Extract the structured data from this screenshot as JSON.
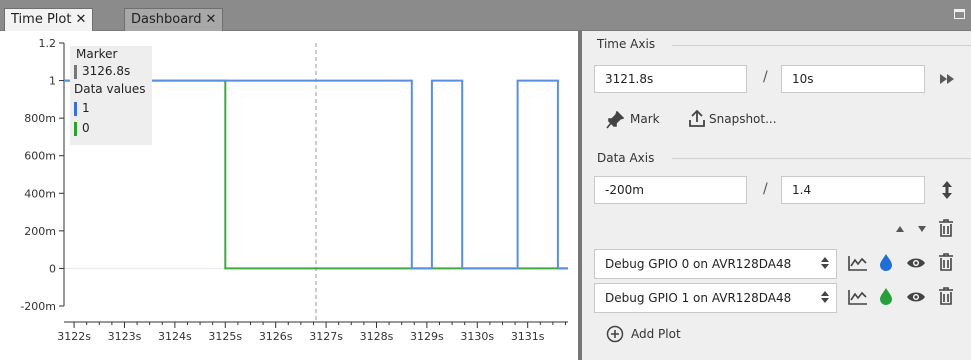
{
  "tabs": [
    {
      "label": "Time Plot",
      "close": "✕"
    },
    {
      "label": "Dashboard",
      "close": "✕"
    }
  ],
  "chart_data": {
    "type": "line",
    "x_ticks": [
      "3122s",
      "3123s",
      "3124s",
      "3125s",
      "3126s",
      "3127s",
      "3128s",
      "3129s",
      "3130s",
      "3131s"
    ],
    "y_ticks": [
      "1.2",
      "1",
      "800m",
      "600m",
      "400m",
      "200m",
      "0",
      "-200m"
    ],
    "y_tick_values": [
      1.2,
      1,
      0.8,
      0.6,
      0.4,
      0.2,
      0,
      -0.2
    ],
    "xlim": [
      3121.8,
      3131.8
    ],
    "ylim": [
      -0.2,
      1.2
    ],
    "marker": 3126.8,
    "series": [
      {
        "color": "#5b8ee0",
        "x": [
          3121.8,
          3128.7,
          3128.7,
          3129.1,
          3129.1,
          3129.7,
          3129.7,
          3130.8,
          3130.8,
          3131.6,
          3131.6,
          3131.8
        ],
        "y": [
          1,
          1,
          0,
          0,
          1,
          1,
          0,
          0,
          1,
          1,
          0,
          0
        ]
      },
      {
        "color": "#3faa3f",
        "x": [
          3121.8,
          3125.0,
          3125.0,
          3131.8
        ],
        "y": [
          1,
          1,
          0,
          0
        ]
      }
    ]
  },
  "legend": {
    "marker_title": "Marker",
    "marker_value": "3126.8s",
    "values_title": "Data values",
    "values": [
      {
        "value": "1",
        "color": "#3b6fdc"
      },
      {
        "value": "0",
        "color": "#2fa02f"
      }
    ]
  },
  "panel": {
    "time_axis_label": "Time Axis",
    "time_start": "3121.8s",
    "time_span": "10s",
    "slash": "/",
    "mark_label": "Mark",
    "snapshot_label": "Snapshot...",
    "data_axis_label": "Data Axis",
    "data_min": "-200m",
    "data_span": "1.4",
    "plots": [
      {
        "source": "Debug GPIO 0 on AVR128DA48",
        "drop_color": "#1f6fd6"
      },
      {
        "source": "Debug GPIO 1 on AVR128DA48",
        "drop_color": "#26a03a"
      }
    ],
    "add_plot_label": "Add Plot"
  }
}
